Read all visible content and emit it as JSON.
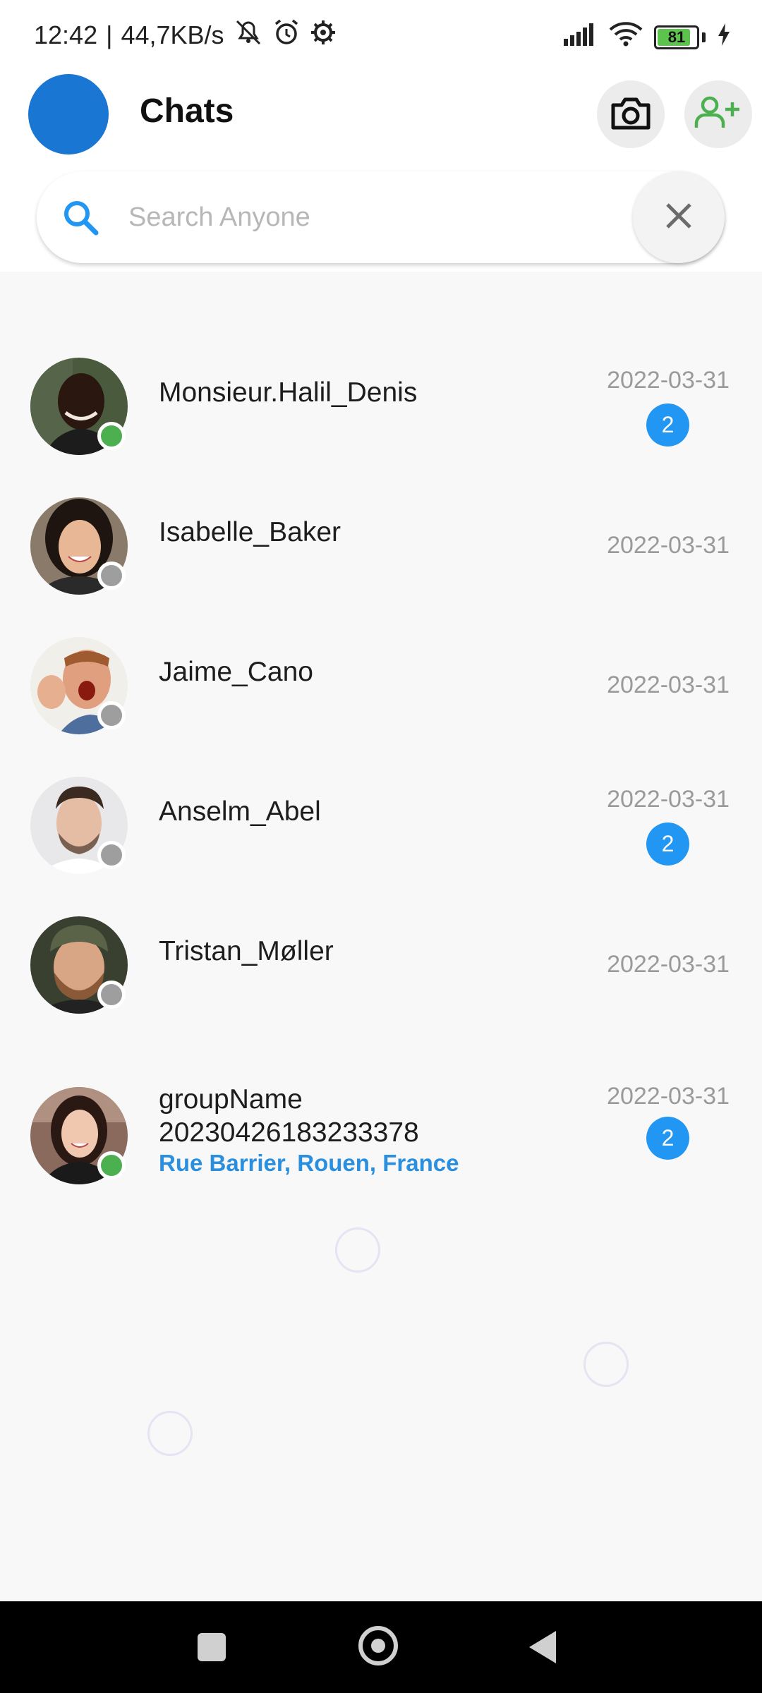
{
  "status_bar": {
    "time": "12:42",
    "separator": "|",
    "speed": "44,7KB/s",
    "battery": "81",
    "icons": [
      "mute-icon",
      "alarm-icon",
      "settings-icon",
      "signal-icon",
      "wifi-icon",
      "battery-icon",
      "charging-icon"
    ]
  },
  "header": {
    "title": "Chats",
    "camera_icon": "camera-icon",
    "add_user_icon": "add-user-icon"
  },
  "search": {
    "placeholder": "Search Anyone",
    "value": ""
  },
  "colors": {
    "profile": "#1976d2",
    "online": "#4caf50",
    "offline": "#9e9e9e",
    "badge": "#2196f3",
    "accent_green": "#4caf50",
    "location": "#2b8fe0"
  },
  "chats": [
    {
      "name": "Monsieur.Halil_Denis",
      "date": "2022-03-31",
      "unread": "2",
      "status": "online"
    },
    {
      "name": "Isabelle_Baker",
      "date": "2022-03-31",
      "unread": "",
      "status": "offline"
    },
    {
      "name": "Jaime_Cano",
      "date": "2022-03-31",
      "unread": "",
      "status": "offline"
    },
    {
      "name": "Anselm_Abel",
      "date": "2022-03-31",
      "unread": "2",
      "status": "offline"
    },
    {
      "name": "Tristan_Møller",
      "date": "2022-03-31",
      "unread": "",
      "status": "offline"
    }
  ],
  "group_chat": {
    "name_line1": "groupName",
    "name_line2": "20230426183233378",
    "location": "Rue Barrier, Rouen, France",
    "date": "2022-03-31",
    "unread": "2",
    "status": "online"
  }
}
